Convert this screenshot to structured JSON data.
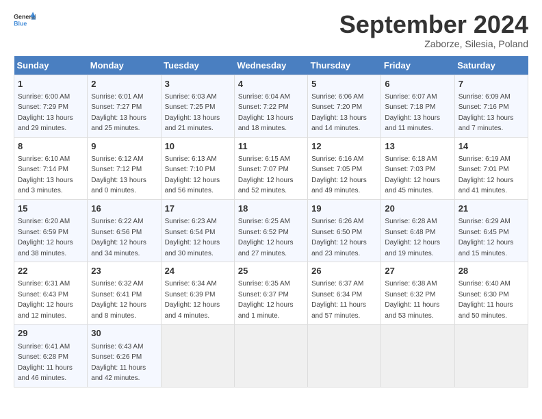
{
  "header": {
    "logo_general": "General",
    "logo_blue": "Blue",
    "month_title": "September 2024",
    "location": "Zaborze, Silesia, Poland"
  },
  "weekdays": [
    "Sunday",
    "Monday",
    "Tuesday",
    "Wednesday",
    "Thursday",
    "Friday",
    "Saturday"
  ],
  "weeks": [
    [
      {
        "day": "1",
        "sunrise": "6:00 AM",
        "sunset": "7:29 PM",
        "daylight": "13 hours and 29 minutes."
      },
      {
        "day": "2",
        "sunrise": "6:01 AM",
        "sunset": "7:27 PM",
        "daylight": "13 hours and 25 minutes."
      },
      {
        "day": "3",
        "sunrise": "6:03 AM",
        "sunset": "7:25 PM",
        "daylight": "13 hours and 21 minutes."
      },
      {
        "day": "4",
        "sunrise": "6:04 AM",
        "sunset": "7:22 PM",
        "daylight": "13 hours and 18 minutes."
      },
      {
        "day": "5",
        "sunrise": "6:06 AM",
        "sunset": "7:20 PM",
        "daylight": "13 hours and 14 minutes."
      },
      {
        "day": "6",
        "sunrise": "6:07 AM",
        "sunset": "7:18 PM",
        "daylight": "13 hours and 11 minutes."
      },
      {
        "day": "7",
        "sunrise": "6:09 AM",
        "sunset": "7:16 PM",
        "daylight": "13 hours and 7 minutes."
      }
    ],
    [
      {
        "day": "8",
        "sunrise": "6:10 AM",
        "sunset": "7:14 PM",
        "daylight": "13 hours and 3 minutes."
      },
      {
        "day": "9",
        "sunrise": "6:12 AM",
        "sunset": "7:12 PM",
        "daylight": "13 hours and 0 minutes."
      },
      {
        "day": "10",
        "sunrise": "6:13 AM",
        "sunset": "7:10 PM",
        "daylight": "12 hours and 56 minutes."
      },
      {
        "day": "11",
        "sunrise": "6:15 AM",
        "sunset": "7:07 PM",
        "daylight": "12 hours and 52 minutes."
      },
      {
        "day": "12",
        "sunrise": "6:16 AM",
        "sunset": "7:05 PM",
        "daylight": "12 hours and 49 minutes."
      },
      {
        "day": "13",
        "sunrise": "6:18 AM",
        "sunset": "7:03 PM",
        "daylight": "12 hours and 45 minutes."
      },
      {
        "day": "14",
        "sunrise": "6:19 AM",
        "sunset": "7:01 PM",
        "daylight": "12 hours and 41 minutes."
      }
    ],
    [
      {
        "day": "15",
        "sunrise": "6:20 AM",
        "sunset": "6:59 PM",
        "daylight": "12 hours and 38 minutes."
      },
      {
        "day": "16",
        "sunrise": "6:22 AM",
        "sunset": "6:56 PM",
        "daylight": "12 hours and 34 minutes."
      },
      {
        "day": "17",
        "sunrise": "6:23 AM",
        "sunset": "6:54 PM",
        "daylight": "12 hours and 30 minutes."
      },
      {
        "day": "18",
        "sunrise": "6:25 AM",
        "sunset": "6:52 PM",
        "daylight": "12 hours and 27 minutes."
      },
      {
        "day": "19",
        "sunrise": "6:26 AM",
        "sunset": "6:50 PM",
        "daylight": "12 hours and 23 minutes."
      },
      {
        "day": "20",
        "sunrise": "6:28 AM",
        "sunset": "6:48 PM",
        "daylight": "12 hours and 19 minutes."
      },
      {
        "day": "21",
        "sunrise": "6:29 AM",
        "sunset": "6:45 PM",
        "daylight": "12 hours and 15 minutes."
      }
    ],
    [
      {
        "day": "22",
        "sunrise": "6:31 AM",
        "sunset": "6:43 PM",
        "daylight": "12 hours and 12 minutes."
      },
      {
        "day": "23",
        "sunrise": "6:32 AM",
        "sunset": "6:41 PM",
        "daylight": "12 hours and 8 minutes."
      },
      {
        "day": "24",
        "sunrise": "6:34 AM",
        "sunset": "6:39 PM",
        "daylight": "12 hours and 4 minutes."
      },
      {
        "day": "25",
        "sunrise": "6:35 AM",
        "sunset": "6:37 PM",
        "daylight": "12 hours and 1 minute."
      },
      {
        "day": "26",
        "sunrise": "6:37 AM",
        "sunset": "6:34 PM",
        "daylight": "11 hours and 57 minutes."
      },
      {
        "day": "27",
        "sunrise": "6:38 AM",
        "sunset": "6:32 PM",
        "daylight": "11 hours and 53 minutes."
      },
      {
        "day": "28",
        "sunrise": "6:40 AM",
        "sunset": "6:30 PM",
        "daylight": "11 hours and 50 minutes."
      }
    ],
    [
      {
        "day": "29",
        "sunrise": "6:41 AM",
        "sunset": "6:28 PM",
        "daylight": "11 hours and 46 minutes."
      },
      {
        "day": "30",
        "sunrise": "6:43 AM",
        "sunset": "6:26 PM",
        "daylight": "11 hours and 42 minutes."
      },
      null,
      null,
      null,
      null,
      null
    ]
  ]
}
